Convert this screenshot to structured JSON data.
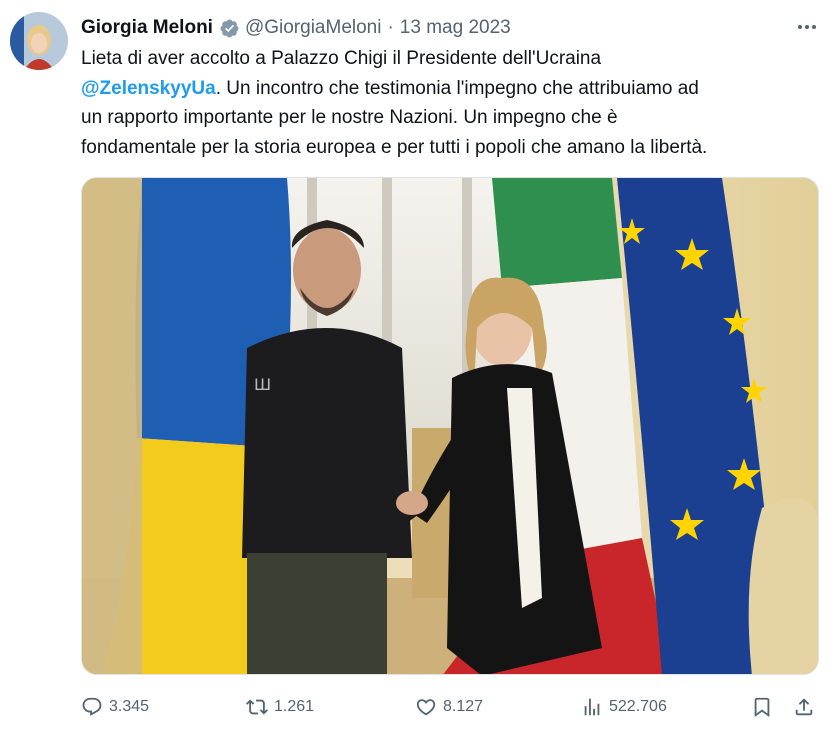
{
  "author": {
    "name": "Giorgia Meloni",
    "handle": "@GiorgiaMeloni",
    "separator": "·",
    "date": "13 mag 2023"
  },
  "tweet": {
    "line1": "Lieta di aver accolto a Palazzo Chigi il Presidente dell'Ucraina",
    "mention": "@ZelenskyyUa",
    "line2_rest": ". Un incontro che testimonia l'impegno che attribuiamo ad",
    "line3": "un rapporto importante per le nostre Nazioni. Un impegno che è",
    "line4": "fondamentale per la storia europea e per tutti i popoli che amano la libertà."
  },
  "stats": {
    "replies": "3.345",
    "retweets": "1.261",
    "likes": "8.127",
    "views": "522.706"
  },
  "colors": {
    "mention": "#1d9bf0",
    "verified_badge": "#829aab",
    "ukraine_blue": "#1f5fb3",
    "ukraine_yellow": "#f2cb1d",
    "italy_green": "#2f8f4e",
    "italy_red": "#c8262b",
    "eu_blue": "#1b3f91",
    "eu_star": "#ffd400"
  }
}
